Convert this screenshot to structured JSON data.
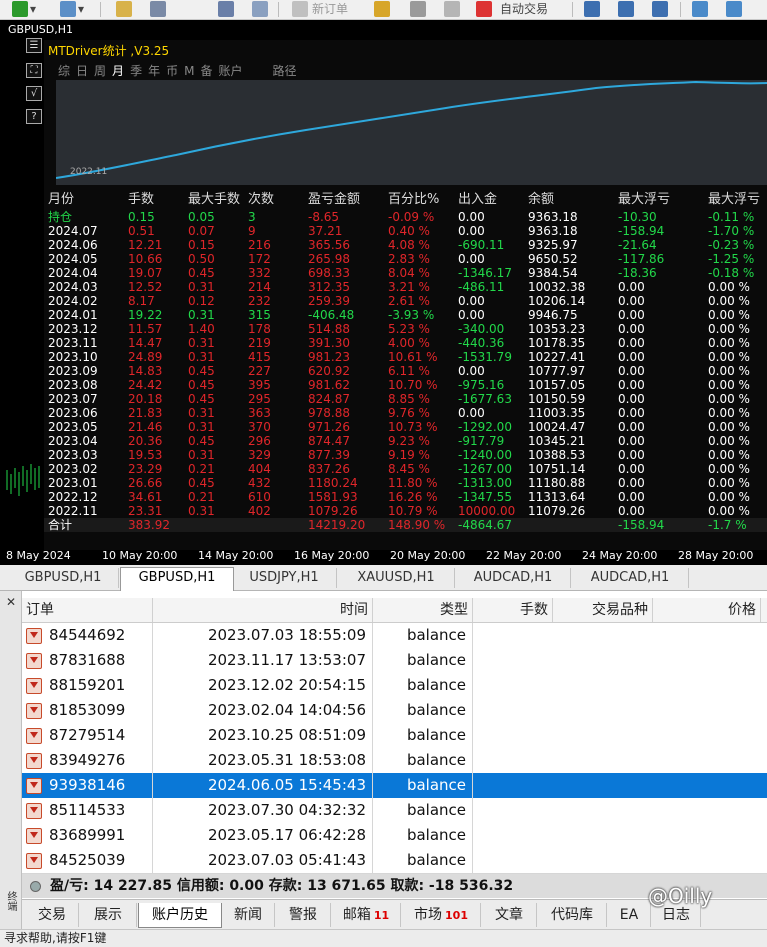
{
  "toolbar": {
    "new_order_label": "新订单",
    "autotrade_label": "自动交易"
  },
  "chart": {
    "symbol_title": "GBPUSD,H1",
    "left_icons": [
      "☰",
      "⛶",
      "√",
      "?"
    ],
    "panel": {
      "title": "MTDriver统计 ,V3.25",
      "tabs": [
        "综",
        "日",
        "周",
        "月",
        "季",
        "年",
        "币",
        "M",
        "备",
        "账户",
        "",
        "路径"
      ],
      "active_tab": "月",
      "curve_start_label": "2022.11",
      "curve_color": "#2ea8dc",
      "headers": [
        "月份",
        "手数",
        "最大手数",
        "次数",
        "盈亏金额",
        "百分比%",
        "出入金",
        "余额",
        "最大浮亏",
        "最大浮亏"
      ],
      "rows": [
        [
          "持仓",
          "0.15",
          "0.05",
          "3",
          "-8.65",
          "-0.09 %",
          "0.00",
          "9363.18",
          "-10.30",
          "-0.11 %"
        ],
        [
          "2024.07",
          "0.51",
          "0.07",
          "9",
          "37.21",
          "0.40 %",
          "0.00",
          "9363.18",
          "-158.94",
          "-1.70 %"
        ],
        [
          "2024.06",
          "12.21",
          "0.15",
          "216",
          "365.56",
          "4.08 %",
          "-690.11",
          "9325.97",
          "-21.64",
          "-0.23 %"
        ],
        [
          "2024.05",
          "10.66",
          "0.50",
          "172",
          "265.98",
          "2.83 %",
          "0.00",
          "9650.52",
          "-117.86",
          "-1.25 %"
        ],
        [
          "2024.04",
          "19.07",
          "0.45",
          "332",
          "698.33",
          "8.04 %",
          "-1346.17",
          "9384.54",
          "-18.36",
          "-0.18 %"
        ],
        [
          "2024.03",
          "12.52",
          "0.31",
          "214",
          "312.35",
          "3.21 %",
          "-486.11",
          "10032.38",
          "0.00",
          "0.00 %"
        ],
        [
          "2024.02",
          "8.17",
          "0.12",
          "232",
          "259.39",
          "2.61 %",
          "0.00",
          "10206.14",
          "0.00",
          "0.00 %"
        ],
        [
          "2024.01",
          "19.22",
          "0.31",
          "315",
          "-406.48",
          "-3.93 %",
          "0.00",
          "9946.75",
          "0.00",
          "0.00 %"
        ],
        [
          "2023.12",
          "11.57",
          "1.40",
          "178",
          "514.88",
          "5.23 %",
          "-340.00",
          "10353.23",
          "0.00",
          "0.00 %"
        ],
        [
          "2023.11",
          "14.47",
          "0.31",
          "219",
          "391.30",
          "4.00 %",
          "-440.36",
          "10178.35",
          "0.00",
          "0.00 %"
        ],
        [
          "2023.10",
          "24.89",
          "0.31",
          "415",
          "981.23",
          "10.61 %",
          "-1531.79",
          "10227.41",
          "0.00",
          "0.00 %"
        ],
        [
          "2023.09",
          "14.83",
          "0.45",
          "227",
          "620.92",
          "6.11 %",
          "0.00",
          "10777.97",
          "0.00",
          "0.00 %"
        ],
        [
          "2023.08",
          "24.42",
          "0.45",
          "395",
          "981.62",
          "10.70 %",
          "-975.16",
          "10157.05",
          "0.00",
          "0.00 %"
        ],
        [
          "2023.07",
          "20.18",
          "0.45",
          "295",
          "824.87",
          "8.85 %",
          "-1677.63",
          "10150.59",
          "0.00",
          "0.00 %"
        ],
        [
          "2023.06",
          "21.83",
          "0.31",
          "363",
          "978.88",
          "9.76 %",
          "0.00",
          "11003.35",
          "0.00",
          "0.00 %"
        ],
        [
          "2023.05",
          "21.46",
          "0.31",
          "370",
          "971.26",
          "10.73 %",
          "-1292.00",
          "10024.47",
          "0.00",
          "0.00 %"
        ],
        [
          "2023.04",
          "20.36",
          "0.45",
          "296",
          "874.47",
          "9.23 %",
          "-917.79",
          "10345.21",
          "0.00",
          "0.00 %"
        ],
        [
          "2023.03",
          "19.53",
          "0.31",
          "329",
          "877.39",
          "9.19 %",
          "-1240.00",
          "10388.53",
          "0.00",
          "0.00 %"
        ],
        [
          "2023.02",
          "23.29",
          "0.21",
          "404",
          "837.26",
          "8.45 %",
          "-1267.00",
          "10751.14",
          "0.00",
          "0.00 %"
        ],
        [
          "2023.01",
          "26.66",
          "0.45",
          "432",
          "1180.24",
          "11.80 %",
          "-1313.00",
          "11180.88",
          "0.00",
          "0.00 %"
        ],
        [
          "2022.12",
          "34.61",
          "0.21",
          "610",
          "1581.93",
          "16.26 %",
          "-1347.55",
          "11313.64",
          "0.00",
          "0.00 %"
        ],
        [
          "2022.11",
          "23.31",
          "0.31",
          "402",
          "1079.26",
          "10.79 %",
          "10000.00",
          "11079.26",
          "0.00",
          "0.00 %"
        ]
      ],
      "total_row": [
        "合计",
        "383.92",
        "",
        "",
        "14219.20",
        "148.90 %",
        "-4864.67",
        "",
        "-158.94",
        "-1.7 %"
      ],
      "colors": {
        "positive": "#e0262a",
        "negative": "#22d84a",
        "neutral": "#ffffff",
        "header": "#dddddd"
      }
    },
    "x_axis_labels": [
      "8 May 2024",
      "10 May 20:00",
      "14 May 20:00",
      "16 May 20:00",
      "20 May 20:00",
      "22 May 20:00",
      "24 May 20:00",
      "28 May 20:00"
    ]
  },
  "symbol_tabs": [
    {
      "label": "GBPUSD,H1",
      "active": false
    },
    {
      "label": "GBPUSD,H1",
      "active": true
    },
    {
      "label": "USDJPY,H1",
      "active": false
    },
    {
      "label": "XAUUSD,H1",
      "active": false
    },
    {
      "label": "AUDCAD,H1",
      "active": false
    },
    {
      "label": "AUDCAD,H1",
      "active": false
    }
  ],
  "terminal": {
    "side_label": "终端",
    "columns": [
      "订单",
      "时间",
      "类型",
      "手数",
      "交易品种",
      "价格"
    ],
    "rows": [
      {
        "order": "84544692",
        "time": "2023.07.03 18:55:09",
        "type": "balance",
        "selected": false
      },
      {
        "order": "87831688",
        "time": "2023.11.17 13:53:07",
        "type": "balance",
        "selected": false
      },
      {
        "order": "88159201",
        "time": "2023.12.02 20:54:15",
        "type": "balance",
        "selected": false
      },
      {
        "order": "81853099",
        "time": "2023.02.04 14:04:56",
        "type": "balance",
        "selected": false
      },
      {
        "order": "87279514",
        "time": "2023.10.25 08:51:09",
        "type": "balance",
        "selected": false
      },
      {
        "order": "83949276",
        "time": "2023.05.31 18:53:08",
        "type": "balance",
        "selected": false
      },
      {
        "order": "93938146",
        "time": "2024.06.05 15:45:43",
        "type": "balance",
        "selected": true
      },
      {
        "order": "85114533",
        "time": "2023.07.30 04:32:32",
        "type": "balance",
        "selected": false
      },
      {
        "order": "83689991",
        "time": "2023.05.17 06:42:28",
        "type": "balance",
        "selected": false
      },
      {
        "order": "84525039",
        "time": "2023.07.03 05:41:43",
        "type": "balance",
        "selected": false
      }
    ],
    "summary": "盈/亏: 14 227.85  信用额: 0.00  存款: 13 671.65  取款: -18 536.32",
    "bottom_tabs": [
      {
        "label": "交易",
        "badge": ""
      },
      {
        "label": "展示",
        "badge": ""
      },
      {
        "label": "账户历史",
        "badge": "",
        "active": true
      },
      {
        "label": "新闻",
        "badge": ""
      },
      {
        "label": "警报",
        "badge": ""
      },
      {
        "label": "邮箱",
        "badge": "11"
      },
      {
        "label": "市场",
        "badge": "101"
      },
      {
        "label": "文章",
        "badge": ""
      },
      {
        "label": "代码库",
        "badge": ""
      },
      {
        "label": "EA",
        "badge": ""
      },
      {
        "label": "日志",
        "badge": ""
      }
    ]
  },
  "watermark": "@Oilly",
  "status_text": "寻求帮助,请按F1键"
}
